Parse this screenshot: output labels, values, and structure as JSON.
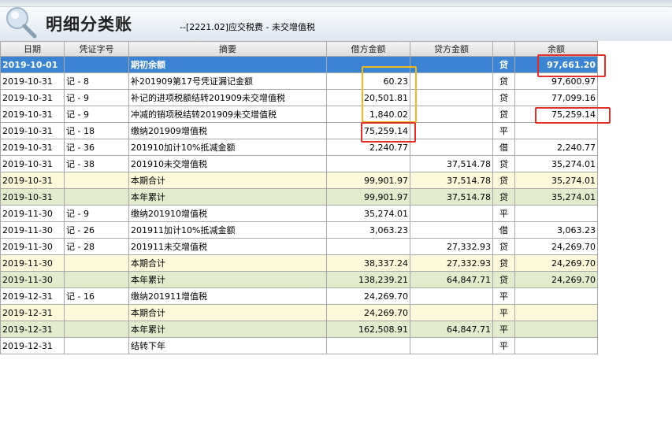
{
  "header": {
    "title": "明细分类账",
    "subtitle": "--[2221.02]应交税费 - 未交增值税"
  },
  "table": {
    "columns": [
      "日期",
      "凭证字号",
      "摘要",
      "借方金额",
      "贷方金额",
      "",
      "余额"
    ],
    "rows": [
      {
        "type": "open",
        "date": "2019-10-01",
        "voucher": "",
        "summary": "期初余额",
        "debit": "",
        "credit": "",
        "dir": "贷",
        "balance": "97,661.20"
      },
      {
        "type": "entry",
        "date": "2019-10-31",
        "voucher": "记 - 8",
        "summary": "补201909第17号凭证漏记金额",
        "debit": "60.23",
        "credit": "",
        "dir": "贷",
        "balance": "97,600.97"
      },
      {
        "type": "entry",
        "date": "2019-10-31",
        "voucher": "记 - 9",
        "summary": "补记的进项税额结转201909未交增值税",
        "debit": "20,501.81",
        "credit": "",
        "dir": "贷",
        "balance": "77,099.16"
      },
      {
        "type": "entry",
        "date": "2019-10-31",
        "voucher": "记 - 9",
        "summary": "冲减的销项税结转201909未交增值税",
        "debit": "1,840.02",
        "credit": "",
        "dir": "贷",
        "balance": "75,259.14"
      },
      {
        "type": "entry",
        "date": "2019-10-31",
        "voucher": "记 - 18",
        "summary": "缴纳201909增值税",
        "debit": "75,259.14",
        "credit": "",
        "dir": "平",
        "balance": ""
      },
      {
        "type": "entry",
        "date": "2019-10-31",
        "voucher": "记 - 36",
        "summary": "201910加计10%抵减金额",
        "debit": "2,240.77",
        "credit": "",
        "dir": "借",
        "balance": "2,240.77"
      },
      {
        "type": "entry",
        "date": "2019-10-31",
        "voucher": "记 - 38",
        "summary": "201910未交增值税",
        "debit": "",
        "credit": "37,514.78",
        "dir": "贷",
        "balance": "35,274.01"
      },
      {
        "type": "period",
        "date": "2019-10-31",
        "voucher": "",
        "summary": "本期合计",
        "debit": "99,901.97",
        "credit": "37,514.78",
        "dir": "贷",
        "balance": "35,274.01"
      },
      {
        "type": "year",
        "date": "2019-10-31",
        "voucher": "",
        "summary": "本年累计",
        "debit": "99,901.97",
        "credit": "37,514.78",
        "dir": "贷",
        "balance": "35,274.01"
      },
      {
        "type": "entry",
        "date": "2019-11-30",
        "voucher": "记 - 9",
        "summary": "缴纳201910增值税",
        "debit": "35,274.01",
        "credit": "",
        "dir": "平",
        "balance": ""
      },
      {
        "type": "entry",
        "date": "2019-11-30",
        "voucher": "记 - 26",
        "summary": "201911加计10%抵减金额",
        "debit": "3,063.23",
        "credit": "",
        "dir": "借",
        "balance": "3,063.23"
      },
      {
        "type": "entry",
        "date": "2019-11-30",
        "voucher": "记 - 28",
        "summary": "201911未交增值税",
        "debit": "",
        "credit": "27,332.93",
        "dir": "贷",
        "balance": "24,269.70"
      },
      {
        "type": "period",
        "date": "2019-11-30",
        "voucher": "",
        "summary": "本期合计",
        "debit": "38,337.24",
        "credit": "27,332.93",
        "dir": "贷",
        "balance": "24,269.70"
      },
      {
        "type": "year",
        "date": "2019-11-30",
        "voucher": "",
        "summary": "本年累计",
        "debit": "138,239.21",
        "credit": "64,847.71",
        "dir": "贷",
        "balance": "24,269.70"
      },
      {
        "type": "entry",
        "date": "2019-12-31",
        "voucher": "记 - 16",
        "summary": "缴纳201911增值税",
        "debit": "24,269.70",
        "credit": "",
        "dir": "平",
        "balance": ""
      },
      {
        "type": "period",
        "date": "2019-12-31",
        "voucher": "",
        "summary": "本期合计",
        "debit": "24,269.70",
        "credit": "",
        "dir": "平",
        "balance": ""
      },
      {
        "type": "year",
        "date": "2019-12-31",
        "voucher": "",
        "summary": "本年累计",
        "debit": "162,508.91",
        "credit": "64,847.71",
        "dir": "平",
        "balance": ""
      },
      {
        "type": "entry",
        "date": "2019-12-31",
        "voucher": "",
        "summary": "结转下年",
        "debit": "",
        "credit": "",
        "dir": "平",
        "balance": ""
      }
    ]
  },
  "colors": {
    "open_row": "#3a84d3",
    "period_row": "#fbf9d9",
    "year_row": "#e2eccd",
    "highlight_red": "#e0302a",
    "highlight_yellow": "#f4b71b"
  },
  "icons": {
    "logo": "magnifier-icon"
  }
}
